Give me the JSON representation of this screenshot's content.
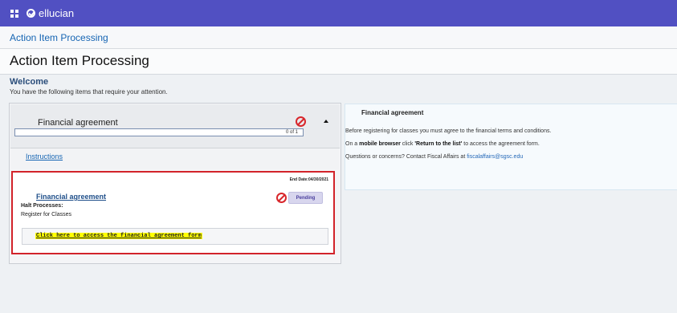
{
  "app": {
    "brand": "ellucian"
  },
  "breadcrumb": "Action Item Processing",
  "page_title": "Action Item Processing",
  "welcome": {
    "title": "Welcome",
    "subtitle": "You have the following items that require your attention."
  },
  "action_item": {
    "title": "Financial agreement",
    "progress_text": "0 of 1",
    "progress_fraction": 0,
    "instructions_label": "Instructions",
    "detail": {
      "end_date": "End Date:04/30/2021",
      "link_label": "Financial agreement",
      "status": "Pending",
      "halt_label": "Halt Processes:",
      "halt_value": "Register for Classes",
      "access_link": "Click here to access the financial agreement form"
    }
  },
  "info_panel": {
    "title": "Financial agreement",
    "line1": "Before registering for classes you must agree to the financial terms and conditions.",
    "line2_pre": "On a ",
    "line2_bold1": "mobile browser",
    "line2_mid": " click ",
    "line2_bold2": "'Return to the list'",
    "line2_post": " to access the agreement form.",
    "line3_pre": "Questions or concerns? Contact Fiscal Affairs at ",
    "email": "fiscalaffairs@sgsc.edu"
  },
  "colors": {
    "topbar": "#5150c2",
    "accent": "#d2232a",
    "link": "#1665b3",
    "highlight": "#ffff00"
  },
  "icons": [
    "apps-grid-icon",
    "ellucian-logo-icon",
    "prohibit-icon",
    "collapse-caret-icon"
  ]
}
